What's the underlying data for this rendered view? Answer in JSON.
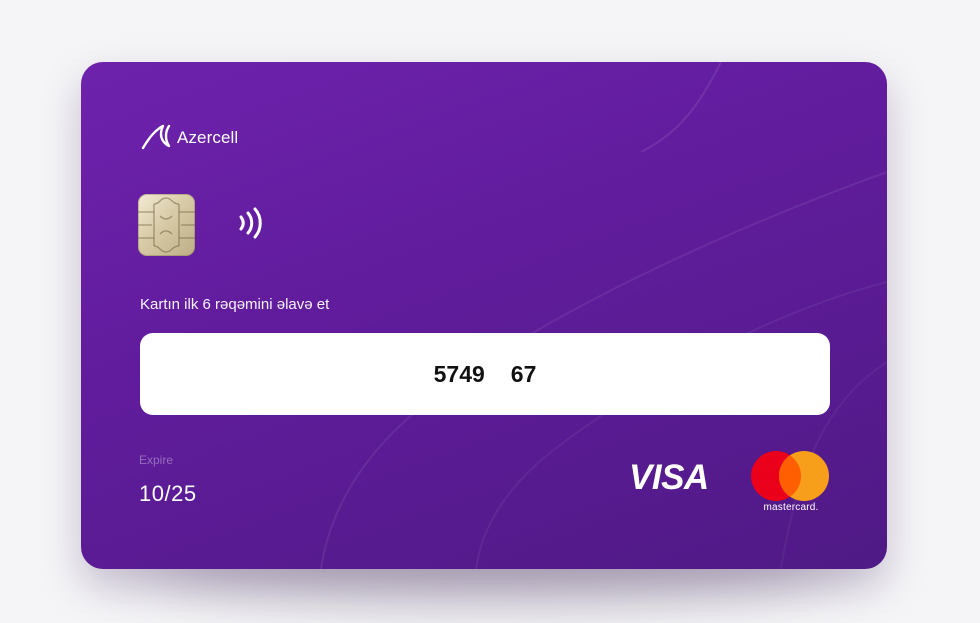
{
  "card": {
    "brand": "Azercell",
    "prompt": "Kartın ilk 6 rəqəmini əlavə et",
    "card_number_part1": "5749",
    "card_number_part2": "67",
    "expire_label": "Expire",
    "expire_value": "10/25",
    "network_visa": "VISA",
    "network_mastercard": "mastercard."
  },
  "colors": {
    "card_gradient_start": "#6e22ad",
    "card_gradient_end": "#4f1a85",
    "input_background": "#ffffff",
    "mastercard_red": "#eb001b",
    "mastercard_orange": "#f79e1b"
  },
  "icons": [
    "azercell-logo-icon",
    "sim-chip-icon",
    "contactless-icon",
    "mastercard-logo-icon"
  ]
}
